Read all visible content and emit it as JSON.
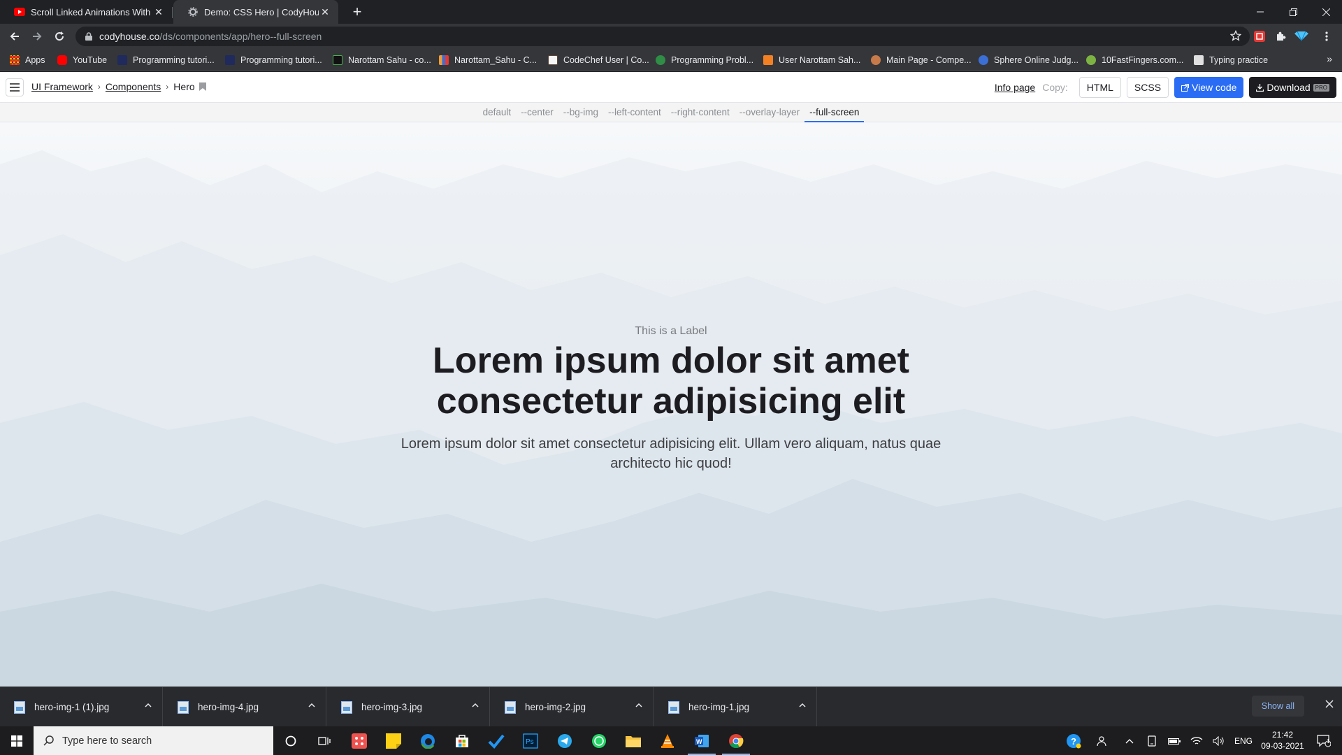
{
  "browser": {
    "tabs": [
      {
        "title": "Scroll Linked Animations With N",
        "active": false
      },
      {
        "title": "Demo: CSS Hero | CodyHouse",
        "active": true
      }
    ],
    "url_host": "codyhouse.co",
    "url_path": "/ds/components/app/hero--full-screen",
    "bookmarks": [
      {
        "label": "Apps",
        "color": "#f4b400"
      },
      {
        "label": "YouTube",
        "color": "#ff0000"
      },
      {
        "label": "Programming tutori...",
        "color": "#202a5c"
      },
      {
        "label": "Programming tutori...",
        "color": "#202a5c"
      },
      {
        "label": "Narottam Sahu - co...",
        "color": "#111111"
      },
      {
        "label": "Narottam_Sahu - C...",
        "color": "#f29d38"
      },
      {
        "label": "CodeChef User | Co...",
        "color": "#5b4638"
      },
      {
        "label": "Programming Probl...",
        "color": "#2f8d46"
      },
      {
        "label": "User Narottam Sah...",
        "color": "#f48024"
      },
      {
        "label": "Main Page - Compe...",
        "color": "#c77b4a"
      },
      {
        "label": "Sphere Online Judg...",
        "color": "#3b6fd6"
      },
      {
        "label": "10FastFingers.com...",
        "color": "#7cb342"
      },
      {
        "label": "Typing practice",
        "color": "#e0e0e0"
      }
    ]
  },
  "app": {
    "breadcrumbs": [
      "UI Framework",
      "Components",
      "Hero"
    ],
    "info_link": "Info page",
    "copy_label": "Copy:",
    "html_btn": "HTML",
    "scss_btn": "SCSS",
    "view_code_btn": "View code",
    "download_btn": "Download",
    "pro_badge": "PRO",
    "variants": [
      "default",
      "--center",
      "--bg-img",
      "--left-content",
      "--right-content",
      "--overlay-layer",
      "--full-screen"
    ],
    "current_variant": "--full-screen"
  },
  "hero": {
    "label": "This is a Label",
    "title_line1": "Lorem ipsum dolor sit amet",
    "title_line2": "consectetur adipisicing elit",
    "text": "Lorem ipsum dolor sit amet consectetur adipisicing elit. Ullam vero aliquam, natus quae architecto hic quod!"
  },
  "downloads": {
    "files": [
      "hero-img-1 (1).jpg",
      "hero-img-4.jpg",
      "hero-img-3.jpg",
      "hero-img-2.jpg",
      "hero-img-1.jpg"
    ],
    "show_all": "Show all"
  },
  "taskbar": {
    "search_placeholder": "Type here to search",
    "language": "ENG",
    "time": "21:42",
    "date": "09-03-2021",
    "notification_count": "1"
  },
  "colors": {
    "accent": "#2a6df4",
    "dark_button": "#1c1c21"
  }
}
